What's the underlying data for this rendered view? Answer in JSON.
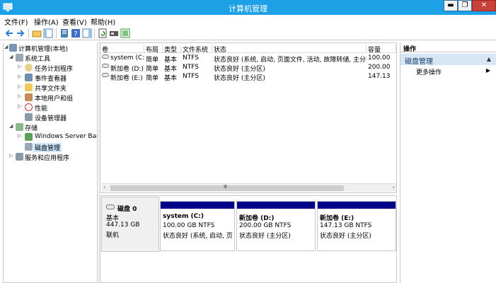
{
  "window": {
    "title": "计算机管理",
    "min": "▬",
    "max": "❐",
    "close": "✕"
  },
  "menu": {
    "file": "文件(F)",
    "action": "操作(A)",
    "view": "查看(V)",
    "help": "帮助(H)"
  },
  "tree": {
    "root": "计算机管理(本地)",
    "system_tools": "系统工具",
    "task_scheduler": "任务计划程序",
    "event_viewer": "事件查看器",
    "shared_folders": "共享文件夹",
    "local_users": "本地用户和组",
    "performance": "性能",
    "device_manager": "设备管理器",
    "storage": "存储",
    "windows_server_backup": "Windows Server Back",
    "disk_management": "磁盘管理",
    "services_apps": "服务和应用程序"
  },
  "volume_list": {
    "columns": {
      "volume": "卷",
      "layout": "布局",
      "type": "类型",
      "fs": "文件系统",
      "status": "状态",
      "capacity": "容量"
    },
    "rows": [
      {
        "volume": "system (C:)",
        "layout": "简单",
        "type": "基本",
        "fs": "NTFS",
        "status": "状态良好 (系统, 启动, 页面文件, 活动, 故障转储, 主分区)",
        "capacity": "100.00"
      },
      {
        "volume": "新加卷 (D:)",
        "layout": "简单",
        "type": "基本",
        "fs": "NTFS",
        "status": "状态良好 (主分区)",
        "capacity": "200.00"
      },
      {
        "volume": "新加卷 (E:)",
        "layout": "简单",
        "type": "基本",
        "fs": "NTFS",
        "status": "状态良好 (主分区)",
        "capacity": "147.13"
      }
    ],
    "scroll_grip": "Ⅲ"
  },
  "disk_graphic": {
    "disk_name": "磁盘 0",
    "disk_type": "基本",
    "disk_size": "447.13 GB",
    "disk_state": "联机",
    "volumes": [
      {
        "name": "system  (C:)",
        "size": "100.00 GB NTFS",
        "status": "状态良好 (系统, 启动, 页面"
      },
      {
        "name": "新加卷  (D:)",
        "size": "200.00 GB NTFS",
        "status": "状态良好 (主分区)"
      },
      {
        "name": "新加卷  (E:)",
        "size": "147.13 GB NTFS",
        "status": "状态良好 (主分区)"
      }
    ]
  },
  "actions": {
    "header": "操作",
    "section": "磁盘管理",
    "more": "更多操作"
  },
  "colors": {
    "titlebar": "#1ea0e6",
    "volume_bar": "#00008b",
    "action_section": "#d6e6f5"
  }
}
